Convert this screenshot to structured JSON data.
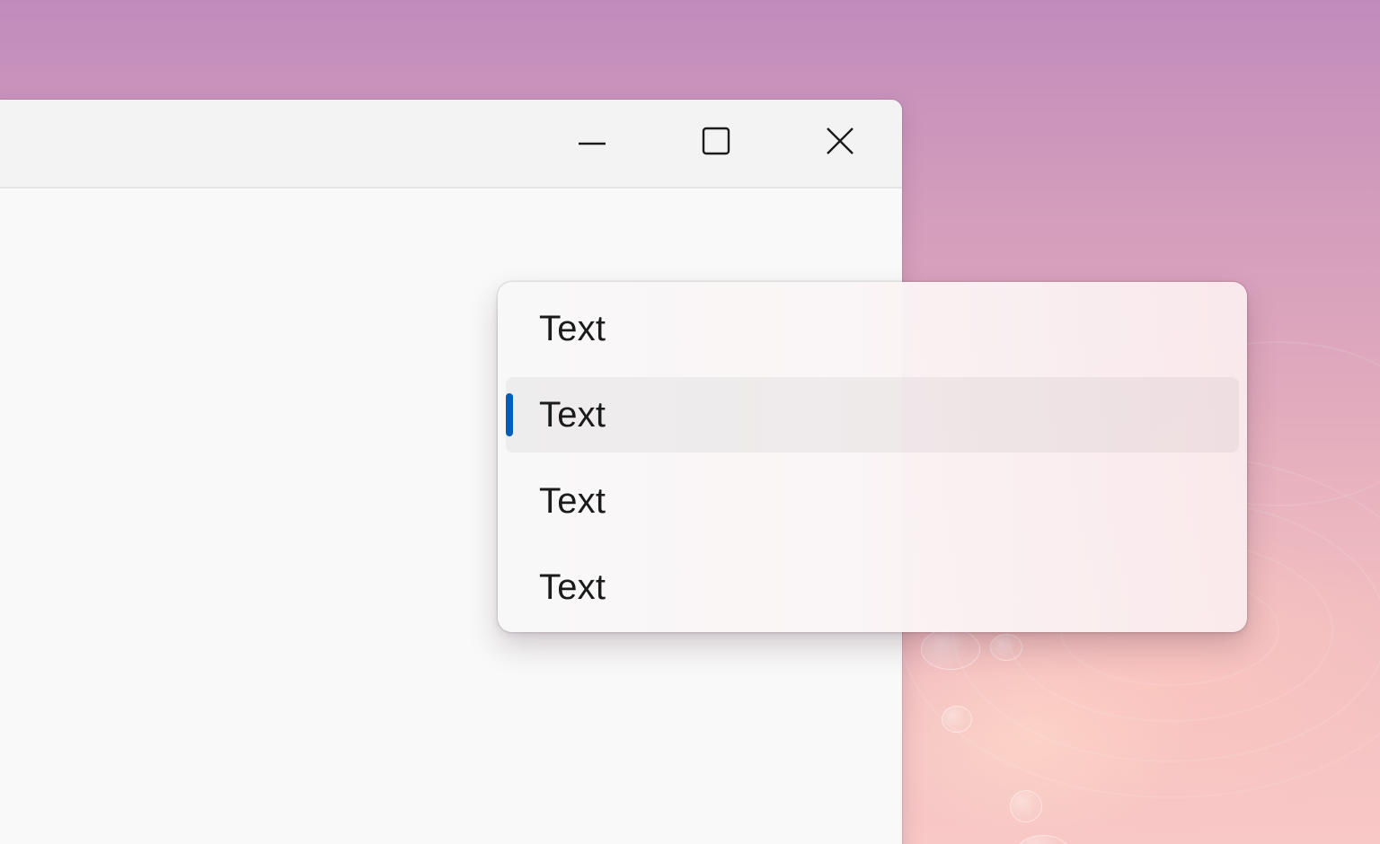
{
  "window": {
    "caption_buttons": [
      {
        "name": "minimize-button",
        "icon": "minimize-icon"
      },
      {
        "name": "maximize-button",
        "icon": "maximize-icon"
      },
      {
        "name": "close-button",
        "icon": "close-icon"
      }
    ]
  },
  "menu": {
    "items": [
      {
        "label": "Text",
        "selected": false
      },
      {
        "label": "Text",
        "selected": true
      },
      {
        "label": "Text",
        "selected": false
      },
      {
        "label": "Text",
        "selected": false
      }
    ],
    "accent_color": "#005fb8"
  },
  "colors": {
    "titlebar": "#f3f3f3",
    "content": "#f9f9f9",
    "text": "#1b1b1b"
  }
}
